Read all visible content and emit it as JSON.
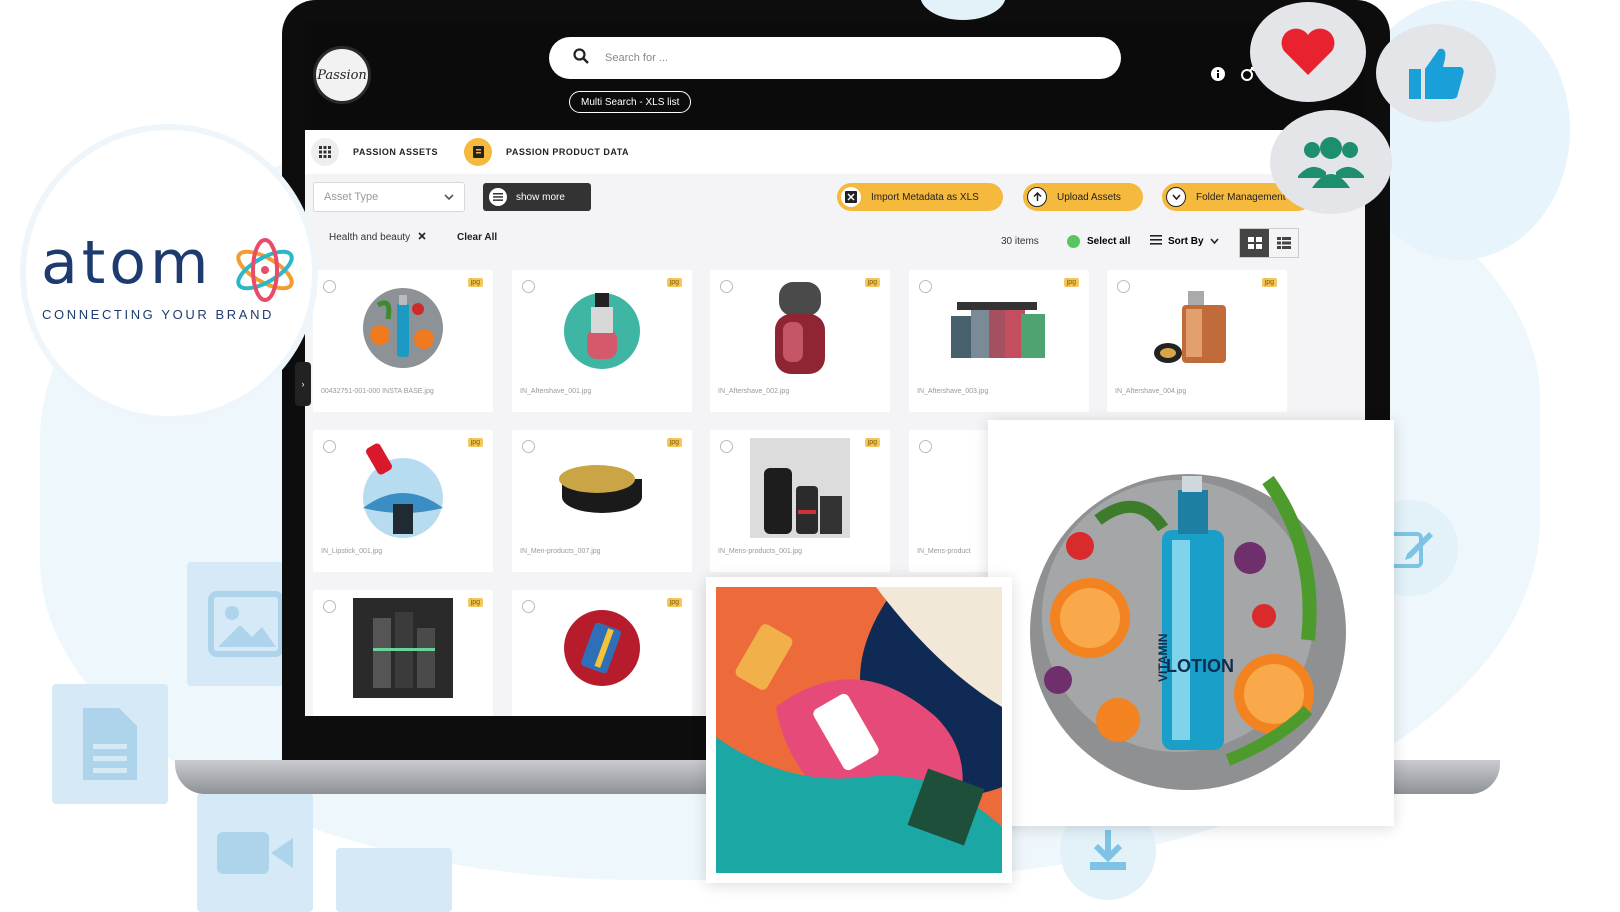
{
  "brand": {
    "wordmark": "atom",
    "tagline": "CONNECTING YOUR BRAND",
    "logo_text": "Passion"
  },
  "header": {
    "search_placeholder": "Search for ...",
    "multi_search_label": "Multi Search - XLS list",
    "icons": [
      "info-icon",
      "share-icon",
      "copy-icon",
      "bag-icon"
    ]
  },
  "tabs": [
    {
      "label": "PASSION ASSETS",
      "icon": "grid-icon"
    },
    {
      "label": "PASSION PRODUCT DATA",
      "icon": "document-icon"
    }
  ],
  "filters": {
    "asset_type_value": "Asset Type",
    "show_more_label": "show more",
    "import_label": "Import Metadata as XLS",
    "upload_label": "Upload Assets",
    "folder_label": "Folder Management"
  },
  "results": {
    "active_filter": "Health and beauty",
    "clear_all": "Clear All",
    "count": "30 items",
    "select_all": "Select all",
    "sort_by": "Sort By"
  },
  "assets": [
    {
      "name": "00432751-001-000 INSTA BASE.jpg",
      "type": "jpg"
    },
    {
      "name": "IN_Aftershave_001.jpg",
      "type": "jpg"
    },
    {
      "name": "IN_Aftershave_002.jpg",
      "type": "jpg"
    },
    {
      "name": "IN_Aftershave_003.jpg",
      "type": "jpg"
    },
    {
      "name": "IN_Aftershave_004.jpg",
      "type": "jpg"
    },
    {
      "name": "IN_Lipstick_001.jpg",
      "type": "jpg"
    },
    {
      "name": "IN_Men-products_007.jpg",
      "type": "jpg"
    },
    {
      "name": "IN_Mens-products_001.jpg",
      "type": "jpg"
    },
    {
      "name": "IN_Mens-product",
      "type": ""
    },
    {
      "name": "",
      "type": "jpg"
    },
    {
      "name": "",
      "type": "jpg"
    }
  ],
  "featured": {
    "bottle_text": "LOTION",
    "bottle_subtext": "VITAMIN",
    "accent": "#1aa0c8"
  },
  "colors": {
    "accent_yellow": "#f5b93e",
    "brand_navy": "#1d3b6e",
    "heart": "#e8232f",
    "people": "#1e8f6e",
    "thumb_up": "#1aa0d8"
  }
}
